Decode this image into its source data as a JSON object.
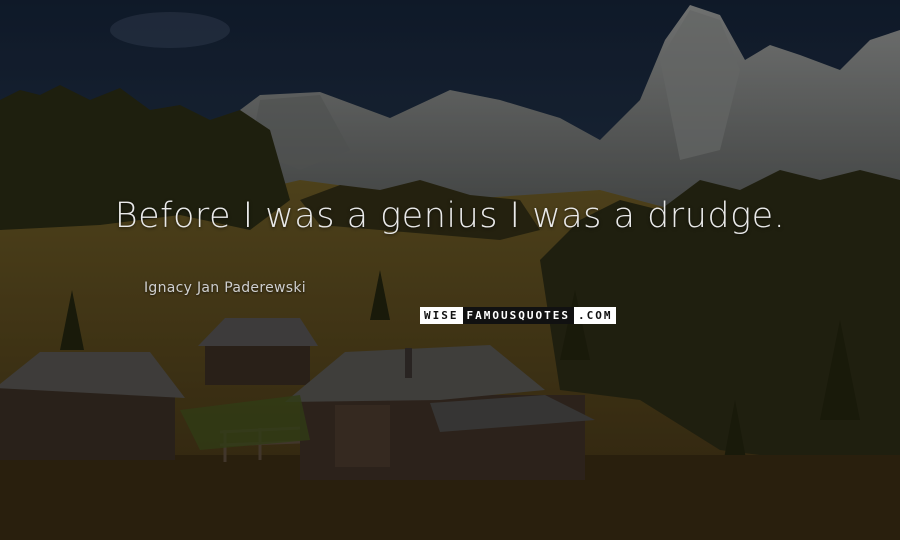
{
  "quote": {
    "text": "Before I was a genius I was a drudge.",
    "author": "Ignacy Jan Paderewski"
  },
  "watermark": {
    "part1": "WISE",
    "part2": "FAMOUSQUOTES",
    "part3": ".COM"
  },
  "colors": {
    "sky": "#1b2b45",
    "mountain": "#7b7f80",
    "meadow": "#5c4a1f",
    "forest": "#2b2c16",
    "cabin": "#3e3128",
    "roof": "#4c4c4c",
    "text": "#e9e9e9"
  }
}
